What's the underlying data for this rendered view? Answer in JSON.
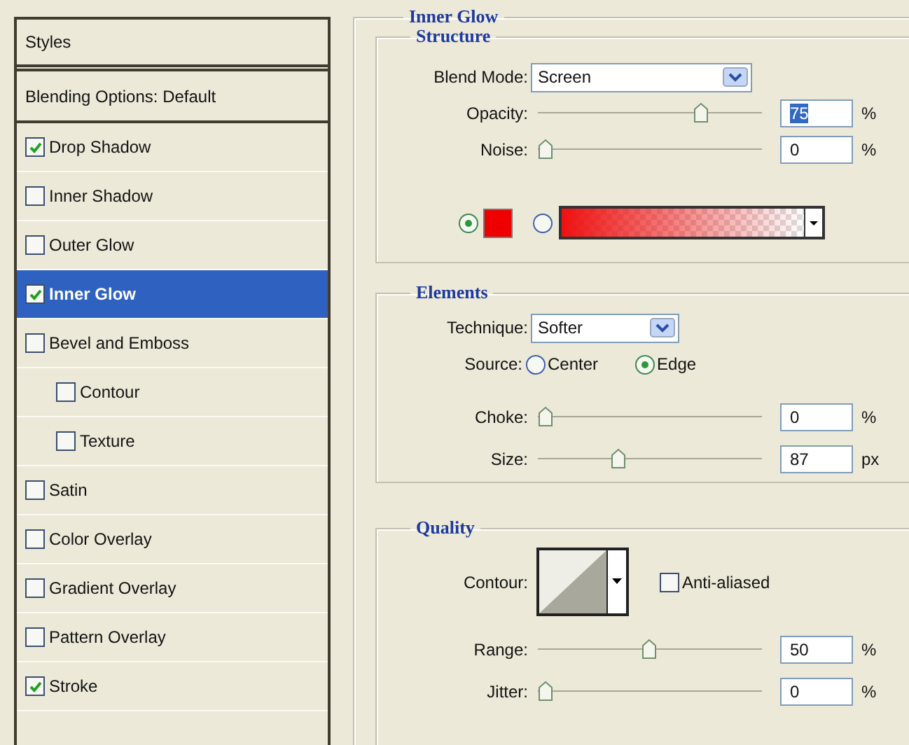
{
  "styles_panel": {
    "title": "Styles",
    "blending_options": "Blending Options: Default",
    "items": [
      {
        "label": "Drop Shadow",
        "checked": true,
        "selected": false
      },
      {
        "label": "Inner Shadow",
        "checked": false,
        "selected": false
      },
      {
        "label": "Outer Glow",
        "checked": false,
        "selected": false
      },
      {
        "label": "Inner Glow",
        "checked": true,
        "selected": true
      },
      {
        "label": "Bevel and Emboss",
        "checked": false,
        "selected": false,
        "children": [
          {
            "label": "Contour",
            "checked": false,
            "selected": false
          },
          {
            "label": "Texture",
            "checked": false,
            "selected": false
          }
        ]
      },
      {
        "label": "Satin",
        "checked": false,
        "selected": false
      },
      {
        "label": "Color Overlay",
        "checked": false,
        "selected": false
      },
      {
        "label": "Gradient Overlay",
        "checked": false,
        "selected": false
      },
      {
        "label": "Pattern Overlay",
        "checked": false,
        "selected": false
      },
      {
        "label": "Stroke",
        "checked": true,
        "selected": false
      }
    ]
  },
  "inner_glow": {
    "title": "Inner Glow",
    "structure": {
      "title": "Structure",
      "blend_mode": {
        "label": "Blend Mode:",
        "value": "Screen"
      },
      "sliders": [
        {
          "label": "Opacity:",
          "level": 0.75,
          "value": "75",
          "unit": "%",
          "text_selected": true
        },
        {
          "label": "Noise:",
          "level": 0,
          "value": "0",
          "unit": "%",
          "text_selected": false
        }
      ],
      "fill_options": [
        {
          "kind": "color",
          "selected": true
        },
        {
          "kind": "gradient",
          "selected": false
        }
      ]
    },
    "elements": {
      "title": "Elements",
      "technique": {
        "label": "Technique:",
        "value": "Softer"
      },
      "source": {
        "label": "Source:",
        "options": [
          {
            "label": "Center",
            "selected": false
          },
          {
            "label": "Edge",
            "selected": true
          }
        ]
      },
      "sliders": [
        {
          "label": "Choke:",
          "level": 0,
          "value": "0",
          "unit": "%",
          "text_selected": false
        },
        {
          "label": "Size:",
          "level": 0.35,
          "value": "87",
          "unit": "px",
          "text_selected": false
        }
      ]
    },
    "quality": {
      "title": "Quality",
      "contour": {
        "label": "Contour:"
      },
      "anti_aliased": {
        "label": "Anti-aliased",
        "checked": false
      },
      "sliders": [
        {
          "label": "Range:",
          "level": 0.5,
          "value": "50",
          "unit": "%",
          "text_selected": false
        },
        {
          "label": "Jitter:",
          "level": 0,
          "value": "0",
          "unit": "%",
          "text_selected": false
        }
      ]
    }
  }
}
